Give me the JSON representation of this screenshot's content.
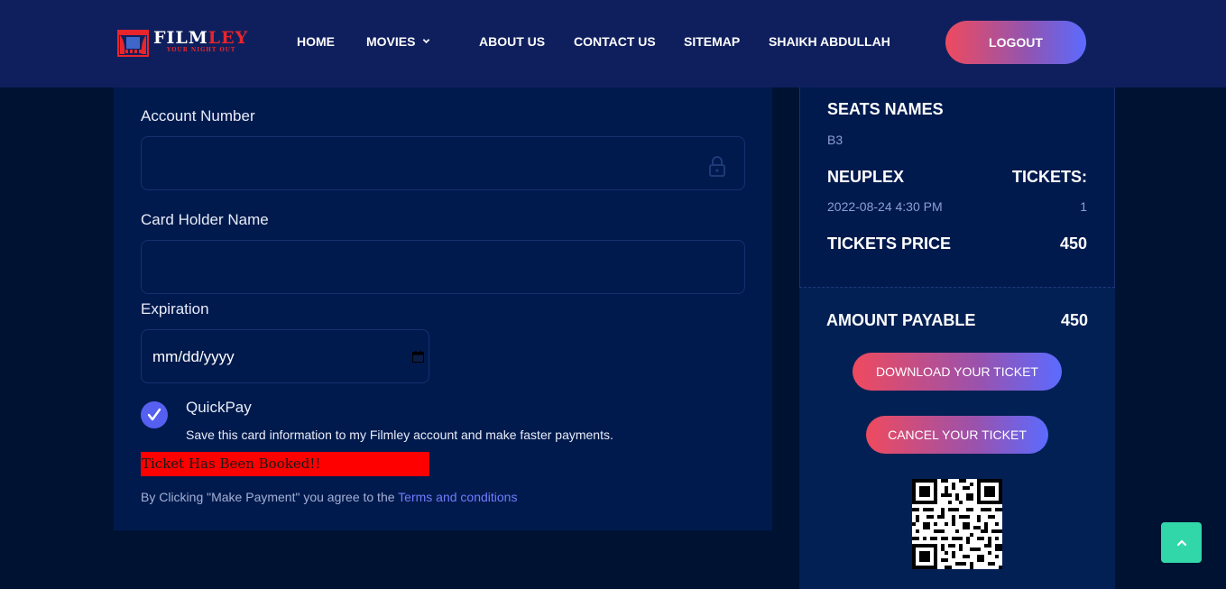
{
  "brand": {
    "name_main": "FILM",
    "name_accent": "LEY",
    "tagline": "YOUR NIGHT OUT"
  },
  "nav": {
    "home": "HOME",
    "movies": "MOVIES",
    "about": "ABOUT US",
    "contact": "CONTACT US",
    "sitemap": "SITEMAP",
    "user": "SHAIKH ABDULLAH",
    "logout": "LOGOUT"
  },
  "form": {
    "account_label": "Account Number",
    "account_value": "",
    "holder_label": "Card Holder Name",
    "holder_value": "",
    "expiration_label": "Expiration",
    "expiration_placeholder": "mm/dd/yyyy",
    "quickpay_title": "QuickPay",
    "quickpay_desc": "Save this card information to my Filmley account and make faster payments.",
    "quickpay_checked": true,
    "booked_message": "Ticket Has Been Booked!!",
    "terms_prefix": "By Clicking \"Make Payment\" you agree to the ",
    "terms_link": "Terms and conditions"
  },
  "summary": {
    "seats_heading": "SEATS NAMES",
    "seats_value": "B3",
    "cinema": "NEUPLEX",
    "tickets_heading": "TICKETS:",
    "showtime": "2022-08-24 4:30 PM",
    "tickets_count": "1",
    "price_heading": "TICKETS PRICE",
    "price_value": "450",
    "payable_heading": "AMOUNT PAYABLE",
    "payable_value": "450",
    "download_label": "DOWNLOAD YOUR TICKET",
    "cancel_label": "CANCEL YOUR TICKET"
  },
  "colors": {
    "header_bg": "#0f1f5d",
    "page_bg": "#001232",
    "panel_bg": "#001a4d",
    "accent_red": "#e8252c",
    "gradient_start": "#ef4a5e",
    "gradient_end": "#5b6bff",
    "scroll_top": "#31d7a9",
    "booked_bg": "#ff0000"
  },
  "icons": {
    "logo": "theater-stage-icon",
    "movies_dropdown": "chevron-down-icon",
    "account_field": "lock-icon",
    "expiration_field": "calendar-icon",
    "quickpay": "checkmark-icon",
    "scroll": "chevron-up-icon"
  }
}
